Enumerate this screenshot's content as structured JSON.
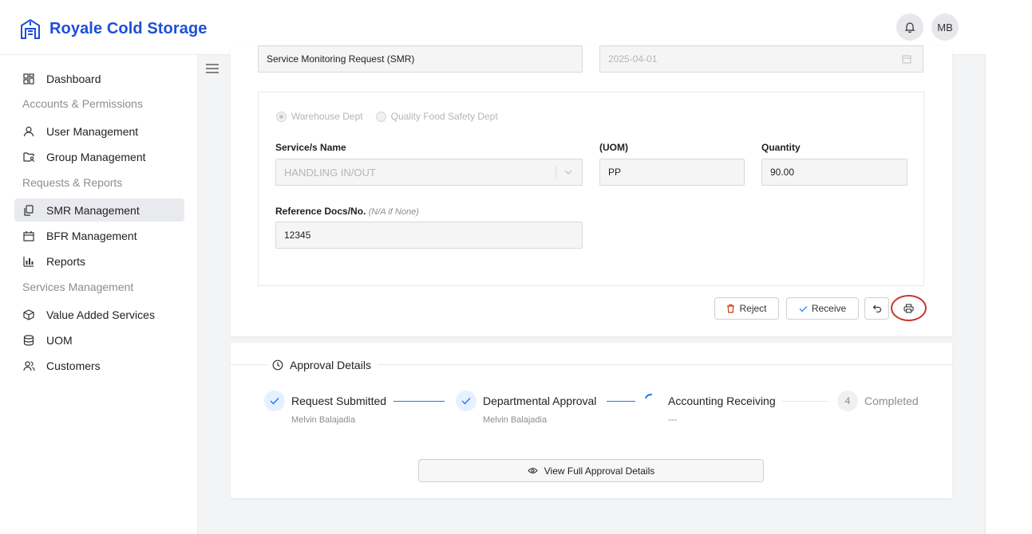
{
  "brand": {
    "name": "Royale Cold Storage"
  },
  "header": {
    "avatar_initials": "MB"
  },
  "sidebar": {
    "items": [
      {
        "label": "Dashboard"
      },
      {
        "group": "Accounts & Permissions"
      },
      {
        "label": "User Management"
      },
      {
        "label": "Group Management"
      },
      {
        "group": "Requests & Reports"
      },
      {
        "label": "SMR Management"
      },
      {
        "label": "BFR Management"
      },
      {
        "label": "Reports"
      },
      {
        "group": "Services Management"
      },
      {
        "label": "Value Added Services"
      },
      {
        "label": "UOM"
      },
      {
        "label": "Customers"
      }
    ]
  },
  "form": {
    "request_type": "Service Monitoring Request (SMR)",
    "date": "2025-04-01",
    "departments": [
      "Warehouse Dept",
      "Quality Food Safety Dept"
    ],
    "service_label": "Service/s Name",
    "service_value": "HANDLING IN/OUT",
    "uom_label": "(UOM)",
    "uom_value": "PP",
    "quantity_label": "Quantity",
    "quantity_value": "90.00",
    "reference_label": "Reference Docs/No.",
    "reference_hint": "(N/A if None)",
    "reference_value": "12345"
  },
  "actions": {
    "reject": "Reject",
    "receive": "Receive"
  },
  "approval": {
    "title": "Approval Details",
    "steps": [
      {
        "title": "Request Submitted",
        "sub": "Melvin Balajadia"
      },
      {
        "title": "Departmental Approval",
        "sub": "Melvin Balajadia"
      },
      {
        "title": "Accounting Receiving",
        "sub": "---"
      },
      {
        "number": "4",
        "title": "Completed"
      }
    ],
    "view_full": "View Full Approval Details"
  },
  "colors": {
    "brand": "#1d4fd8",
    "step_done": "#1677ff",
    "reject": "#d4380d",
    "highlight": "#c8352a"
  }
}
